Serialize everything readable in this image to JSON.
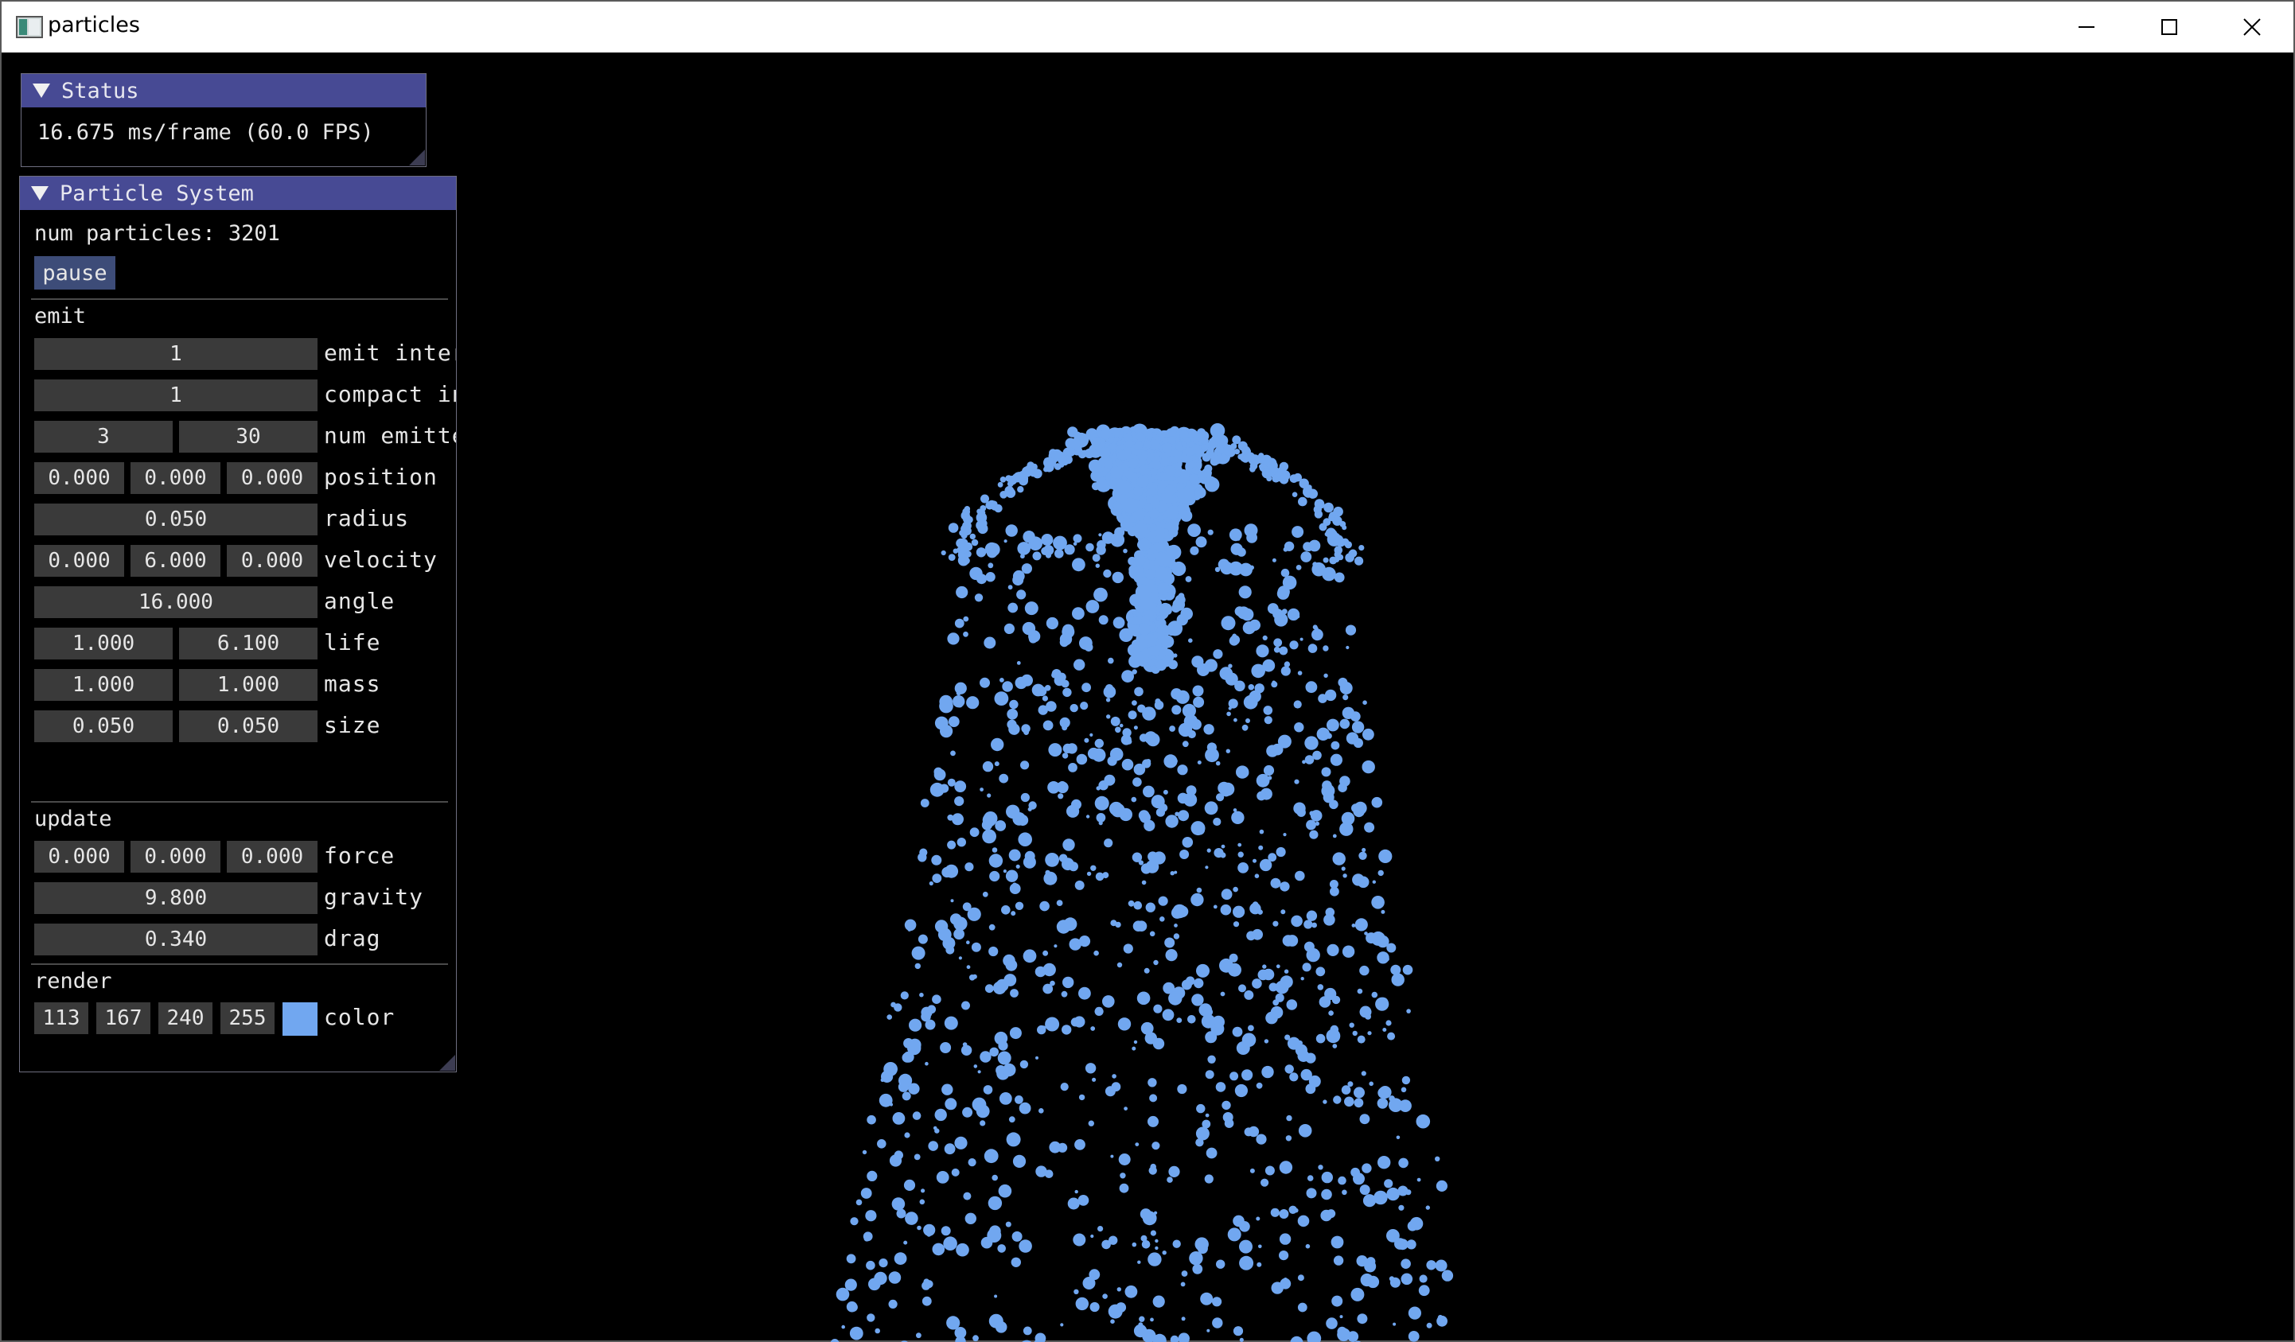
{
  "window": {
    "title": "particles",
    "icon": "app-window-icon",
    "controls": [
      "minimize-icon",
      "maximize-icon",
      "close-icon"
    ]
  },
  "status_panel": {
    "title": "Status",
    "text": "16.675 ms/frame (60.0 FPS)"
  },
  "particle_system": {
    "title": "Particle System",
    "num_particles": "num particles: 3201",
    "pause_label": "pause",
    "emit": {
      "heading": "emit",
      "emit_interval": {
        "value": "1",
        "label": "emit interval"
      },
      "compact_interval": {
        "value": "1",
        "label": "compact interval"
      },
      "num_emitters": {
        "values": [
          "3",
          "30"
        ],
        "label": "num emitters"
      },
      "position": {
        "values": [
          "0.000",
          "0.000",
          "0.000"
        ],
        "label": "position"
      },
      "radius": {
        "value": "0.050",
        "label": "radius"
      },
      "velocity": {
        "values": [
          "0.000",
          "6.000",
          "0.000"
        ],
        "label": "velocity"
      },
      "angle": {
        "value": "16.000",
        "label": "angle"
      },
      "life": {
        "values": [
          "1.000",
          "6.100"
        ],
        "label": "life"
      },
      "mass": {
        "values": [
          "1.000",
          "1.000"
        ],
        "label": "mass"
      },
      "size": {
        "values": [
          "0.050",
          "0.050"
        ],
        "label": "size"
      }
    },
    "update": {
      "heading": "update",
      "force": {
        "values": [
          "0.000",
          "0.000",
          "0.000"
        ],
        "label": "force"
      },
      "gravity": {
        "value": "9.800",
        "label": "gravity"
      },
      "drag": {
        "value": "0.340",
        "label": "drag"
      }
    },
    "render": {
      "heading": "render",
      "color": {
        "values": [
          "113",
          "167",
          "240",
          "255"
        ],
        "label": "color",
        "swatch": "#71a7f0"
      }
    }
  },
  "colors": {
    "particle": "#71a7f0",
    "panel_header": "#474a94",
    "field_bg": "#3a3a3a",
    "button_bg": "#3d4c78",
    "background": "#000000"
  }
}
